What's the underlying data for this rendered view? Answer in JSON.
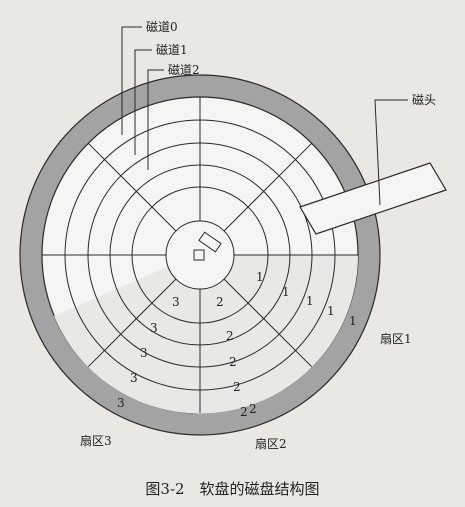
{
  "track_labels": [
    "磁道0",
    "磁道1",
    "磁道2"
  ],
  "head_label": "磁头",
  "sector_labels": [
    "扇区1",
    "扇区2",
    "扇区3"
  ],
  "sector_numbers": {
    "s1": [
      "1",
      "1",
      "1",
      "1",
      "1"
    ],
    "s2": [
      "2",
      "2",
      "2",
      "2",
      "2",
      "2"
    ],
    "s3": [
      "3",
      "3",
      "3",
      "3",
      "3"
    ]
  },
  "caption": "图3-2　软盘的磁盘结构图",
  "colors": {
    "band": "#a3a3a3",
    "paper": "#f5f5f3",
    "line": "#2a2a2a"
  }
}
